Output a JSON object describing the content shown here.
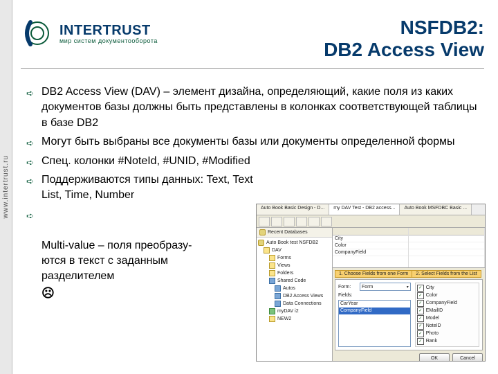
{
  "sidebar_url": "www.intertrust.ru",
  "logo": {
    "brand": "INTERTRUST",
    "tagline": "мир систем документооборота"
  },
  "title": {
    "line1": "NSFDB2:",
    "line2": "DB2 Access View"
  },
  "bullets": [
    "DB2 Access View (DAV) – элемент дизайна, определяющий, какие поля из каких документов базы должны быть представлены в колонках соответствующей таблицы в базе DB2",
    "Могут быть выбраны все документы базы или документы определенной формы",
    "Спец. колонки #NoteId, #UNID, #Modified",
    "Поддерживаются типы данных: Text, Text List, Time, Number",
    "Multi-value – поля преобразу-\nются в текст с заданным\nразделителем"
  ],
  "sad_icon": "☹",
  "screenshot": {
    "tabs": [
      "Auto Book Basic Design - D...",
      "my DAV Test - DB2 access...",
      "Auto Book MSFDBC Basic ..."
    ],
    "toolbar_buttons": 6,
    "left_header": "Recent Databases",
    "tree": [
      {
        "indent": 0,
        "icon": "db",
        "label": "Auto Book test NSFDB2"
      },
      {
        "indent": 1,
        "icon": "fld",
        "label": "DAV"
      },
      {
        "indent": 2,
        "icon": "fld",
        "label": "Forms"
      },
      {
        "indent": 2,
        "icon": "fld",
        "label": "Views"
      },
      {
        "indent": 2,
        "icon": "fld",
        "label": "Folders"
      },
      {
        "indent": 2,
        "icon": "blue",
        "label": "Shared Code"
      },
      {
        "indent": 3,
        "icon": "blue",
        "label": "Autos"
      },
      {
        "indent": 3,
        "icon": "blue",
        "label": "DB2 Access Views"
      },
      {
        "indent": 3,
        "icon": "blue",
        "label": "Data Connections"
      },
      {
        "indent": 2,
        "icon": "green",
        "label": "myDAV i2"
      },
      {
        "indent": 2,
        "icon": "fld",
        "label": "NEW2"
      }
    ],
    "grid": {
      "headers": [
        "",
        ""
      ],
      "rows": [
        [
          "City",
          ""
        ],
        [
          "Color",
          ""
        ],
        [
          "CompanyField",
          ""
        ]
      ]
    },
    "panel": {
      "tabs": [
        "1. Choose Fields from one Form",
        "2. Select Fields from the List"
      ],
      "form_label": "Form:",
      "form_value": "Form",
      "fields_label": "Fields:",
      "listbox": [
        "CarYear",
        "CompanyField"
      ],
      "listbox_selected": 1,
      "checkboxes": [
        "City",
        "Color",
        "CompanyField",
        "EMailID",
        "Model",
        "NoteID",
        "Photo",
        "Rank"
      ],
      "buttons": [
        "OK",
        "Cancel"
      ]
    }
  }
}
